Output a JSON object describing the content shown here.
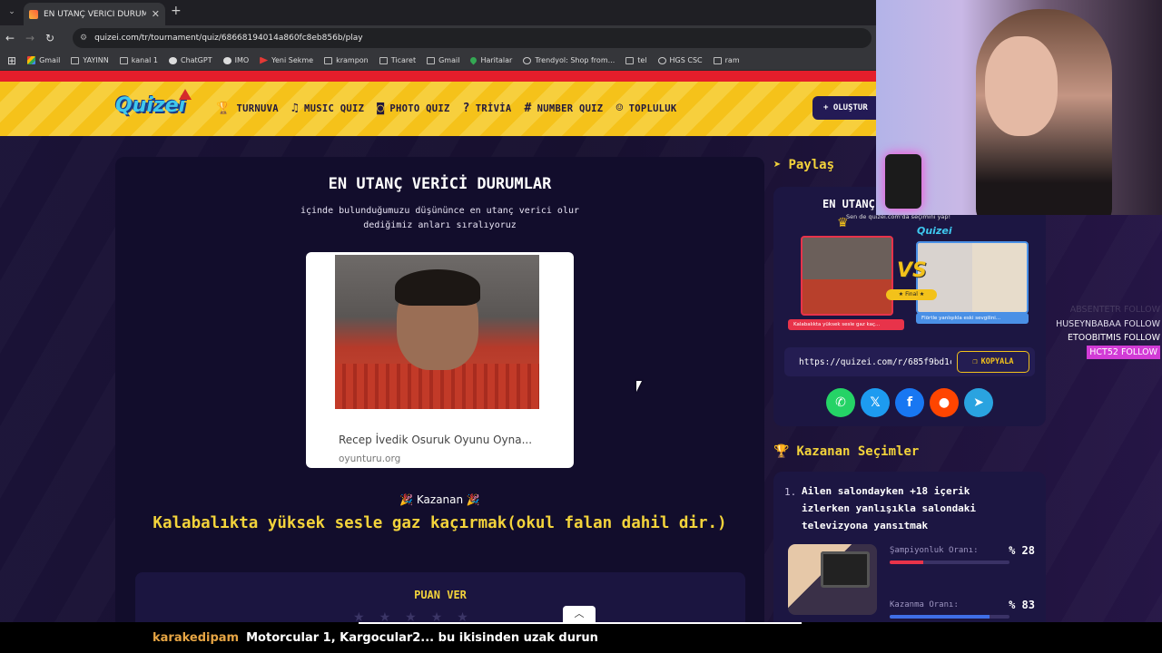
{
  "browser": {
    "tab_title": "EN UTANÇ VERİCİ DURUMLAR",
    "url": "quizei.com/tr/tournament/quiz/68668194014a860fc8eb856b/play",
    "bookmarks": [
      "Gmail",
      "YAYINN",
      "kanal 1",
      "ChatGPT",
      "IMO",
      "Yeni Sekme",
      "krampon",
      "Ticaret",
      "Gmail",
      "Haritalar",
      "Trendyol: Shop from...",
      "tel",
      "HGS CSC",
      "ram"
    ]
  },
  "site": {
    "logo": "Quizei",
    "nav": [
      "TURNUVA",
      "MUSIC QUIZ",
      "PHOTO QUIZ",
      "TRİVİA",
      "NUMBER QUIZ",
      "TOPLULUK"
    ],
    "create_label": "+ OLUŞTUR"
  },
  "quiz": {
    "title": "EN UTANÇ VERİCİ DURUMLAR",
    "description": "içinde bulunduğumuzu düşününce en utanç verici olur dediğimiz anları sıralıyoruz",
    "image_caption": "Recep İvedik Osuruk Oyunu Oyna...",
    "image_source": "oyunturu.org",
    "winner_label": "🎉  Kazanan  🎉",
    "winner_text": "Kalabalıkta yüksek sesle gaz kaçırmak(okul falan dahil dir.)",
    "rate_title": "PUAN VER"
  },
  "share": {
    "title": "Paylaş",
    "card_title": "EN UTANÇ",
    "card_sub": "Sen de quizei.com'da seçimini yap!",
    "card_logo": "Quizei",
    "card_final": "★ Final ★",
    "left_caption": "Kalabalıkta yüksek sesle gaz kaç...",
    "right_caption": "Flörtle yanlışıkla eski sevgilini...",
    "left_image_caption": "Recep İvedik Osuruk Oyunu Oyna...",
    "link": "https://quizei.com/r/685f9bd1c",
    "copy_label": "KOPYALA"
  },
  "winners": {
    "title": "Kazanan Seçimler",
    "items": [
      {
        "rank": "1.",
        "text": "Ailen salondayken +18 içerik izlerken yanlışıkla salondaki televizyona yansıtmak",
        "champ_label": "Şampiyonluk Oranı:",
        "champ_value": "% 28",
        "champ_pct": 28,
        "win_label": "Kazanma Oranı:",
        "win_value": "% 83",
        "win_pct": 83
      }
    ]
  },
  "overlay": {
    "follows": [
      {
        "name": "ABSENTETR",
        "action": "FOLLOW"
      },
      {
        "name": "HUSEYNBABAA",
        "action": "FOLLOW"
      },
      {
        "name": "ETOOBITMIS",
        "action": "FOLLOW"
      },
      {
        "name": "HCT52",
        "action": "FOLLOW"
      }
    ],
    "chat_user": "karakedipam",
    "chat_message": "Motorcular 1, Kargocular2... bu ikisinden uzak durun"
  },
  "colors": {
    "accent_yellow": "#f3d33b",
    "nav_yellow": "#f5c21a",
    "panel_bg": "#120d2c",
    "red": "#e41e2b",
    "champ_bar": "#e8334a",
    "win_bar": "#3f6ee6"
  }
}
